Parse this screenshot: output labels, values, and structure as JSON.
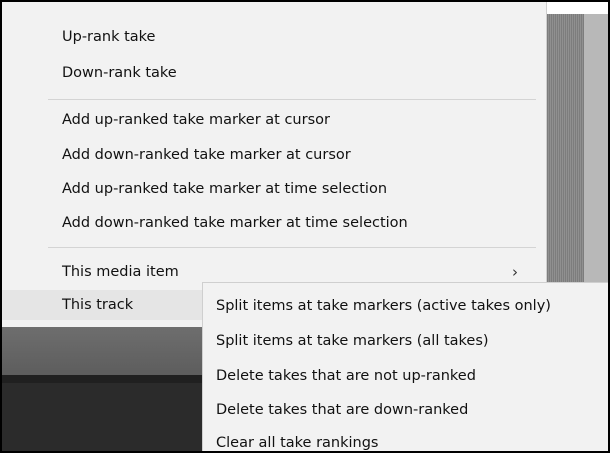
{
  "menu": {
    "group1": [
      {
        "label": "Up-rank take"
      },
      {
        "label": "Down-rank take"
      }
    ],
    "group2": [
      {
        "label": "Add up-ranked take marker at cursor"
      },
      {
        "label": "Add down-ranked take marker at cursor"
      },
      {
        "label": "Add up-ranked take marker at time selection"
      },
      {
        "label": "Add down-ranked take marker at time selection"
      }
    ],
    "group3": [
      {
        "label": "This media item",
        "chevron": "›"
      },
      {
        "label": "This track"
      }
    ]
  },
  "submenu": {
    "items": [
      {
        "label": "Split items at take markers (active takes only)"
      },
      {
        "label": "Split items at take markers (all takes)"
      },
      {
        "label": "Delete takes that are not up-ranked"
      },
      {
        "label": "Delete takes that are down-ranked"
      },
      {
        "label": "Clear all take rankings"
      }
    ]
  }
}
